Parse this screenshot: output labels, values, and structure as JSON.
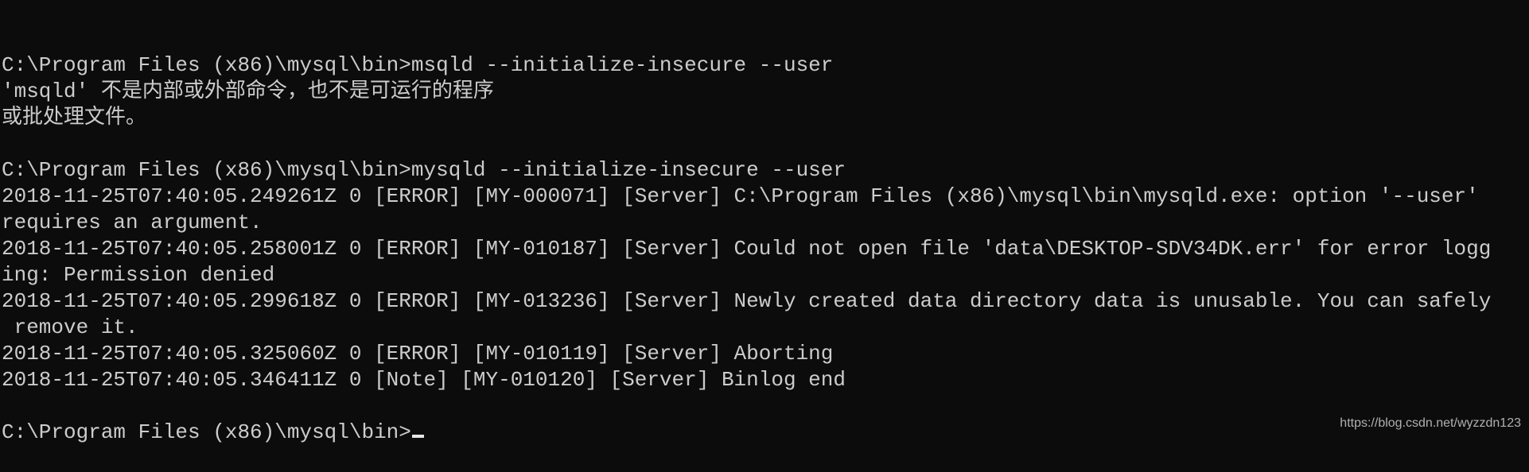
{
  "console": {
    "lines": [
      "C:\\Program Files (x86)\\mysql\\bin>msqld --initialize-insecure --user",
      "'msqld' 不是内部或外部命令，也不是可运行的程序",
      "或批处理文件。",
      "",
      "C:\\Program Files (x86)\\mysql\\bin>mysqld --initialize-insecure --user",
      "2018-11-25T07:40:05.249261Z 0 [ERROR] [MY-000071] [Server] C:\\Program Files (x86)\\mysql\\bin\\mysqld.exe: option '--user'",
      "requires an argument.",
      "2018-11-25T07:40:05.258001Z 0 [ERROR] [MY-010187] [Server] Could not open file 'data\\DESKTOP-SDV34DK.err' for error logg",
      "ing: Permission denied",
      "2018-11-25T07:40:05.299618Z 0 [ERROR] [MY-013236] [Server] Newly created data directory data is unusable. You can safely",
      " remove it.",
      "2018-11-25T07:40:05.325060Z 0 [ERROR] [MY-010119] [Server] Aborting",
      "2018-11-25T07:40:05.346411Z 0 [Note] [MY-010120] [Server] Binlog end",
      ""
    ],
    "prompt": "C:\\Program Files (x86)\\mysql\\bin>"
  },
  "watermark": "https://blog.csdn.net/wyzzdn123",
  "colors": {
    "background": "#0c0c0c",
    "text": "#cccccc"
  }
}
